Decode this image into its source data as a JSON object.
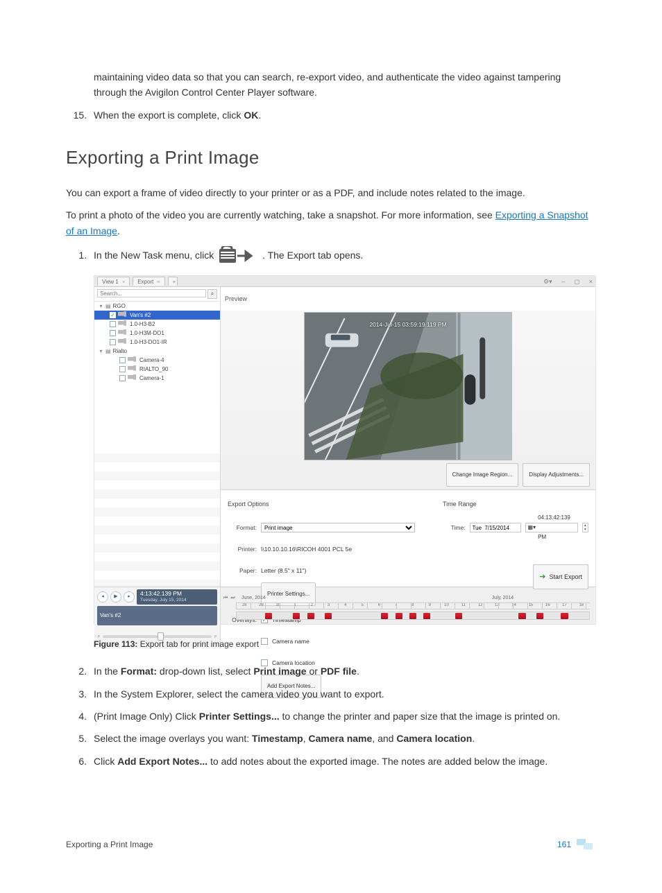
{
  "doc": {
    "lead_in": "maintaining video data so that you can search, re-export video, and authenticate the video against tampering through the Avigilon Control Center Player software.",
    "step15_a": "When the export is complete, click ",
    "step15_b": "OK",
    "step15_c": ".",
    "heading": "Exporting a Print Image",
    "intro": "You can export a frame of video directly to your printer or as a PDF, and include notes related to the image.",
    "para2_a": "To print a photo of the video you are currently watching, take a snapshot. For more information, see ",
    "para2_link": "Exporting a Snapshot of an Image",
    "para2_b": ".",
    "steps": {
      "s1_a": "In the New Task menu, click ",
      "s1_b": ". The Export tab opens.",
      "s2_a": "In the ",
      "s2_b": "Format:",
      "s2_c": " drop-down list, select ",
      "s2_d": "Print image",
      "s2_e": " or ",
      "s2_f": "PDF file",
      "s2_g": ".",
      "s3": "In the System Explorer, select the camera video you want to export.",
      "s4_a": "(Print Image Only) Click ",
      "s4_b": "Printer Settings...",
      "s4_c": " to change the printer and paper size that the image is printed on.",
      "s5_a": "Select the image overlays you want: ",
      "s5_b": "Timestamp",
      "s5_c": ", ",
      "s5_d": "Camera name",
      "s5_e": ", and ",
      "s5_f": "Camera location",
      "s5_g": ".",
      "s6_a": "Click ",
      "s6_b": "Add Export Notes...",
      "s6_c": " to add notes about the exported image. The notes are added below the image."
    },
    "fig_label": "Figure 113:",
    "fig_caption": "Export tab for print image export",
    "footer_text": "Exporting a Print Image",
    "page_no": "161"
  },
  "shot": {
    "tabs": {
      "view": "View 1",
      "export": "Export",
      "close": "×",
      "add": "+"
    },
    "sysbtns": {
      "gear": "⚙▾",
      "min": "–",
      "max": "◻",
      "close": "×"
    },
    "search_placeholder": "Search...",
    "search_icon": "⌕",
    "tree": {
      "server1": "RGO",
      "selected": "Van's #2",
      "cams1": [
        "1.0-H3-B2",
        "1.0-H3M-DO1",
        "1.0-H3-DO1-IR"
      ],
      "server2": "Rialto",
      "cams2": [
        "Camera-4",
        "RIALTO_90",
        "Camera-1"
      ]
    },
    "preview_label": "Preview",
    "timestamp": "2014-Jul-15 03:59:19.119 PM",
    "btn_region": "Change Image Region...",
    "btn_adjust": "Display Adjustments...",
    "opts": {
      "hdr_left": "Export Options",
      "hdr_right": "Time Range",
      "format_label": "Format:",
      "format_value": "Print image",
      "printer_label": "Printer:",
      "printer_value": "\\\\10.10.10.16\\RICOH 4001 PCL 5e",
      "paper_label": "Paper:",
      "paper_value": "Letter (8.5\" x 11\")",
      "printer_settings": "Printer Settings...",
      "overlays_label": "Overlays:",
      "ov_timestamp": "Timestamp",
      "ov_camname": "Camera name",
      "ov_camloc": "Camera location",
      "add_notes": "Add Export Notes...",
      "time_label": "Time:",
      "date_value": "Tue  7/15/2014",
      "time_value": "04:13:42:139 PM"
    },
    "start_export": "Start Export",
    "timeline": {
      "clock": "4:13:42.139 PM",
      "date": "Tuesday, July 15, 2014",
      "cam_label": "Van's #2",
      "month_left": "June, 2014",
      "month_right": "July, 2014",
      "dates": [
        "28",
        "29",
        "30",
        "1",
        "2",
        "3",
        "4",
        "5",
        "6",
        "7",
        "8",
        "9",
        "10",
        "11",
        "12",
        "13",
        "14",
        "15",
        "16",
        "17",
        "18"
      ]
    }
  }
}
